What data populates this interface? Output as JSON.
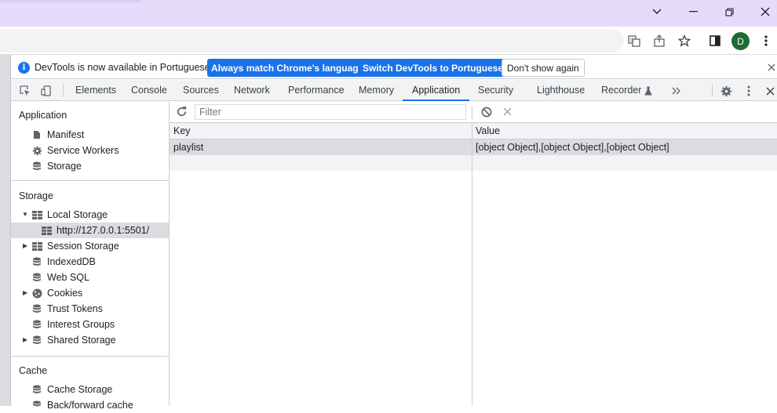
{
  "window": {
    "controls": [
      "chevron-down",
      "minimize",
      "restore",
      "close"
    ]
  },
  "browser": {
    "avatar_letter": "D"
  },
  "infobar": {
    "message": "DevTools is now available in Portuguese!",
    "btn_match": "Always match Chrome's language",
    "btn_switch": "Switch DevTools to Portuguese",
    "btn_dismiss": "Don't show again"
  },
  "tabs": [
    "Elements",
    "Console",
    "Sources",
    "Network",
    "Performance",
    "Memory",
    "Application",
    "Security",
    "Lighthouse",
    "Recorder"
  ],
  "active_tab": "Application",
  "sidebar": {
    "application": {
      "title": "Application",
      "items": [
        "Manifest",
        "Service Workers",
        "Storage"
      ]
    },
    "storage": {
      "title": "Storage",
      "local_storage": "Local Storage",
      "local_origin": "http://127.0.0.1:5501/",
      "items": [
        "Session Storage",
        "IndexedDB",
        "Web SQL",
        "Cookies",
        "Trust Tokens",
        "Interest Groups",
        "Shared Storage"
      ]
    },
    "cache": {
      "title": "Cache",
      "items": [
        "Cache Storage",
        "Back/forward cache"
      ]
    }
  },
  "toolbar": {
    "filter_placeholder": "Filter"
  },
  "grid": {
    "headers": [
      "Key",
      "Value"
    ],
    "rows": [
      {
        "key": "playlist",
        "value": "[object Object],[object Object],[object Object]"
      }
    ]
  },
  "colors": {
    "accent": "#1a73e8",
    "titlebar": "#e6dcfa"
  }
}
